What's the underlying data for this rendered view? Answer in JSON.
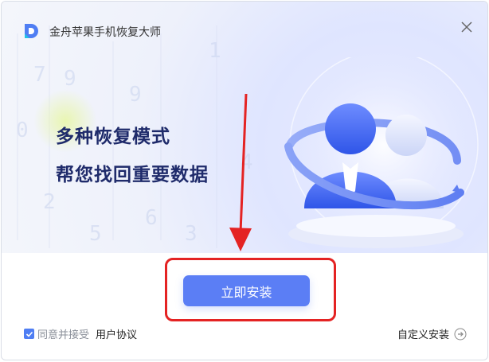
{
  "app": {
    "title": "金舟苹果手机恢复大师"
  },
  "banner": {
    "headline": "多种恢复模式",
    "subline": "帮您找回重要数据"
  },
  "actions": {
    "install_label": "立即安装",
    "custom_install_label": "自定义安装"
  },
  "agreement": {
    "checked": true,
    "agree_text": "同意并接受",
    "link_text": "用户协议"
  },
  "icons": {
    "logo": "app-logo-icon",
    "close": "close-icon",
    "custom": "arrow-right-circle-icon",
    "check": "checkmark-icon"
  },
  "colors": {
    "accent": "#5b7ef5",
    "highlight_border": "#e42323",
    "headline": "#1f2b6b",
    "banner_bg": "#eef1fb"
  }
}
